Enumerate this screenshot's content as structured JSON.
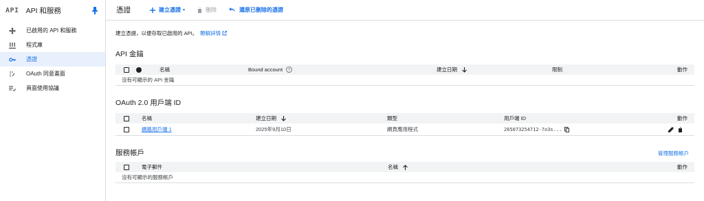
{
  "sidebar": {
    "logo": "API",
    "title": "API 和服務",
    "items": [
      {
        "label": "已啟用的 API 和服務",
        "icon": "enabled-apis-icon"
      },
      {
        "label": "程式庫",
        "icon": "library-icon"
      },
      {
        "label": "憑證",
        "icon": "key-icon",
        "active": true
      },
      {
        "label": "OAuth 同意畫面",
        "icon": "oauth-consent-icon"
      },
      {
        "label": "頁面使用協議",
        "icon": "page-usage-agreements-icon"
      }
    ]
  },
  "toolbar": {
    "title": "憑證",
    "create": "建立憑證",
    "delete": "刪除",
    "restore": "還原已刪除的憑證"
  },
  "intro": {
    "text": "建立憑證，以便存取已啟用的 API。",
    "link": "瞭解詳情"
  },
  "api_keys": {
    "title": "API 金鑰",
    "columns": [
      "名稱",
      "Bound account",
      "建立日期",
      "限制",
      "動作"
    ],
    "empty": "沒有可顯示的 API 金鑰"
  },
  "oauth": {
    "title": "OAuth 2.0 用戶端 ID",
    "columns": [
      "名稱",
      "建立日期",
      "類型",
      "用戶端 ID",
      "動作"
    ],
    "rows": [
      {
        "name": "網路用戶端 1",
        "date": "2025年9月10日",
        "type": "網頁應用程式",
        "client_id": "265073254712-7o3s..."
      }
    ]
  },
  "service_accounts": {
    "title": "服務帳戶",
    "manage": "管理服務帳戶",
    "columns": [
      "電子郵件",
      "名稱",
      "動作"
    ],
    "empty": "沒有可顯示的服務帳戶"
  },
  "colors": {
    "accent": "#1a73e8",
    "active_bg": "#e8f0fe",
    "header_bg": "#f1f3f4"
  }
}
